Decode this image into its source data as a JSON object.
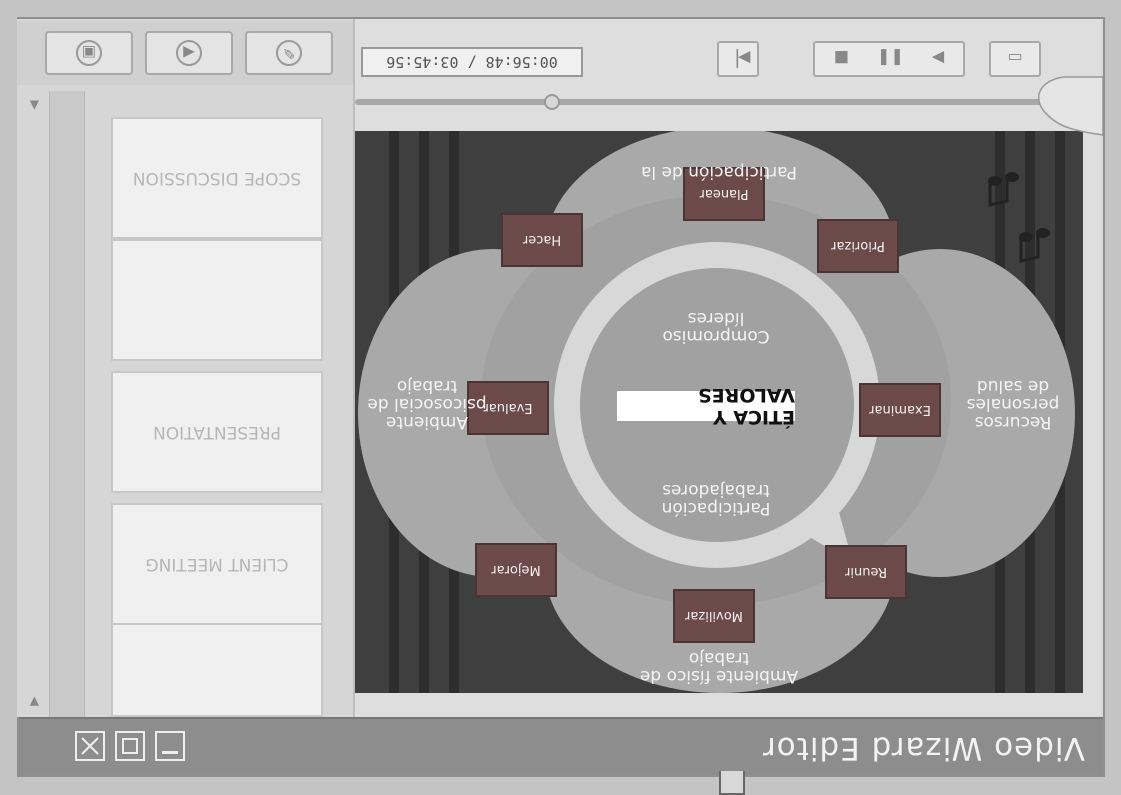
{
  "window": {
    "title": "Video Wizard Editor",
    "buttons": [
      "minimize",
      "maximize",
      "close"
    ]
  },
  "slide": {
    "center_title": "ÉTICA Y VALORES",
    "steps": [
      "Planear",
      "Hacer",
      "Evaluar",
      "Mejorar",
      "Movilizar",
      "Reunir",
      "Examinar",
      "Priorizar"
    ],
    "labels": {
      "top": "Participación de la",
      "right": "Ambiente psicosocial de trabajo",
      "bottom": "Ambiente físico de trabajo",
      "left": "Recursos personales de salud",
      "inner_top": "Participación trabajadores",
      "inner_bottom": "Compromiso líderes"
    }
  },
  "player": {
    "timecode": "00:56:48 / 03:45:56",
    "progress": 0.28
  },
  "thumbnails": [
    {
      "label": ""
    },
    {
      "label": "CLIENT MEETING"
    },
    {
      "label": "PRESENTATION"
    },
    {
      "label": ""
    },
    {
      "label": "SCOPE DISCUSSION"
    },
    {
      "label": ""
    }
  ],
  "icons": {
    "tools": [
      "pencil-icon",
      "back-icon",
      "save-icon"
    ],
    "controls": [
      "snapshot-icon",
      "play-icon",
      "pause-icon",
      "stop-icon",
      "frame-step-icon"
    ]
  }
}
